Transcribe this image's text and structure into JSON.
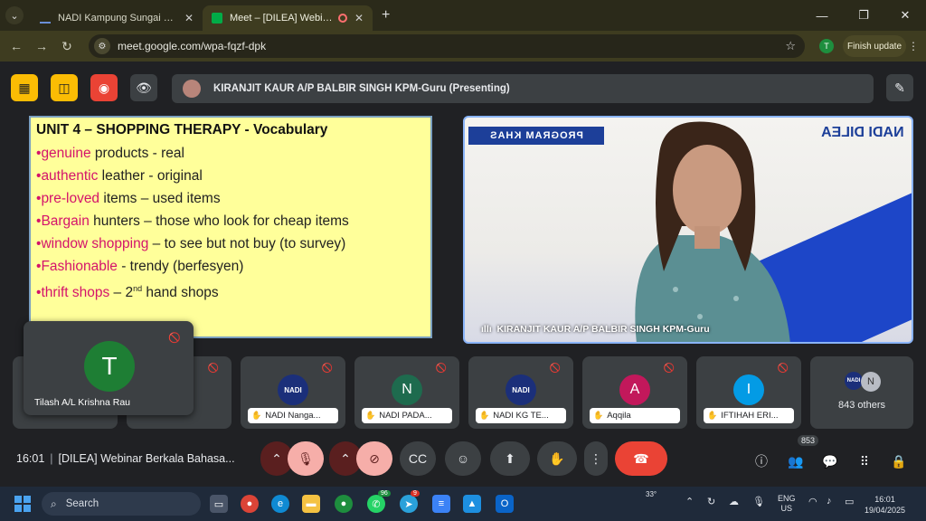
{
  "browser": {
    "tabs": [
      {
        "title": "NADI Kampung Sungai Rambai"
      },
      {
        "title": "Meet – [DILEA] Webinar Berkala Bahasa Inggeris"
      }
    ],
    "url": "meet.google.com/wpa-fqzf-dpk",
    "profile_initial": "T",
    "update_label": "Finish update"
  },
  "meet": {
    "presenting_label": "KIRANJIT KAUR A/P BALBIR SINGH KPM-Guru (Presenting)",
    "slide": {
      "title": "UNIT 4 – SHOPPING THERAPY - Vocabulary",
      "lines": [
        {
          "hl": "genuine",
          "rest": " products  - real"
        },
        {
          "hl": "authentic",
          "rest": " leather - original"
        },
        {
          "hl": "pre-loved",
          "rest": " items – used items"
        },
        {
          "hl": "Bargain",
          "rest": " hunters – those who look for cheap items"
        },
        {
          "hl": "window shopping",
          "rest": " – to see but not buy (to survey)"
        },
        {
          "hl": "Fashionable",
          "rest": " - trendy (berfesyen)"
        },
        {
          "hl": "thrift shops",
          "rest": " – 2",
          "sup": "nd",
          "tail": " hand shops"
        }
      ]
    },
    "video": {
      "banner_left": "PROGRAM KHAS",
      "banner_right": "NADI DILEA",
      "speaker_name": "KIRANJIT KAUR A/P BALBIR SINGH KPM-Guru"
    },
    "floating_tile": {
      "initial": "T",
      "name": "Tilash A/L Krishna Rau"
    },
    "participants": [
      {
        "initial": "NADI",
        "name": "NADI Nanga...",
        "color": "#1b2f7a",
        "nadi": true
      },
      {
        "initial": "N",
        "name": "NADI PADA...",
        "color": "#1e6b4e",
        "nadi": false
      },
      {
        "initial": "NADI",
        "name": "NADI KG TE...",
        "color": "#1b2f7a",
        "nadi": true
      },
      {
        "initial": "A",
        "name": "Aqqila",
        "color": "#c2185b",
        "nadi": false
      },
      {
        "initial": "I",
        "name": "IFTIHAH ERI...",
        "color": "#039be5",
        "nadi": false
      }
    ],
    "others": {
      "avatar_a": "NADI",
      "avatar_b": "N",
      "label": "843 others"
    },
    "controls": {
      "time": "16:01",
      "meeting_title": "[DILEA] Webinar Berkala Bahasa...",
      "people_count": "853"
    }
  },
  "taskbar": {
    "search_label": "Search",
    "badge_whatsapp": "96",
    "badge_telegram": "9",
    "weather": "33°",
    "lang": "ENG",
    "region": "US",
    "time": "16:01",
    "date": "19/04/2025"
  }
}
